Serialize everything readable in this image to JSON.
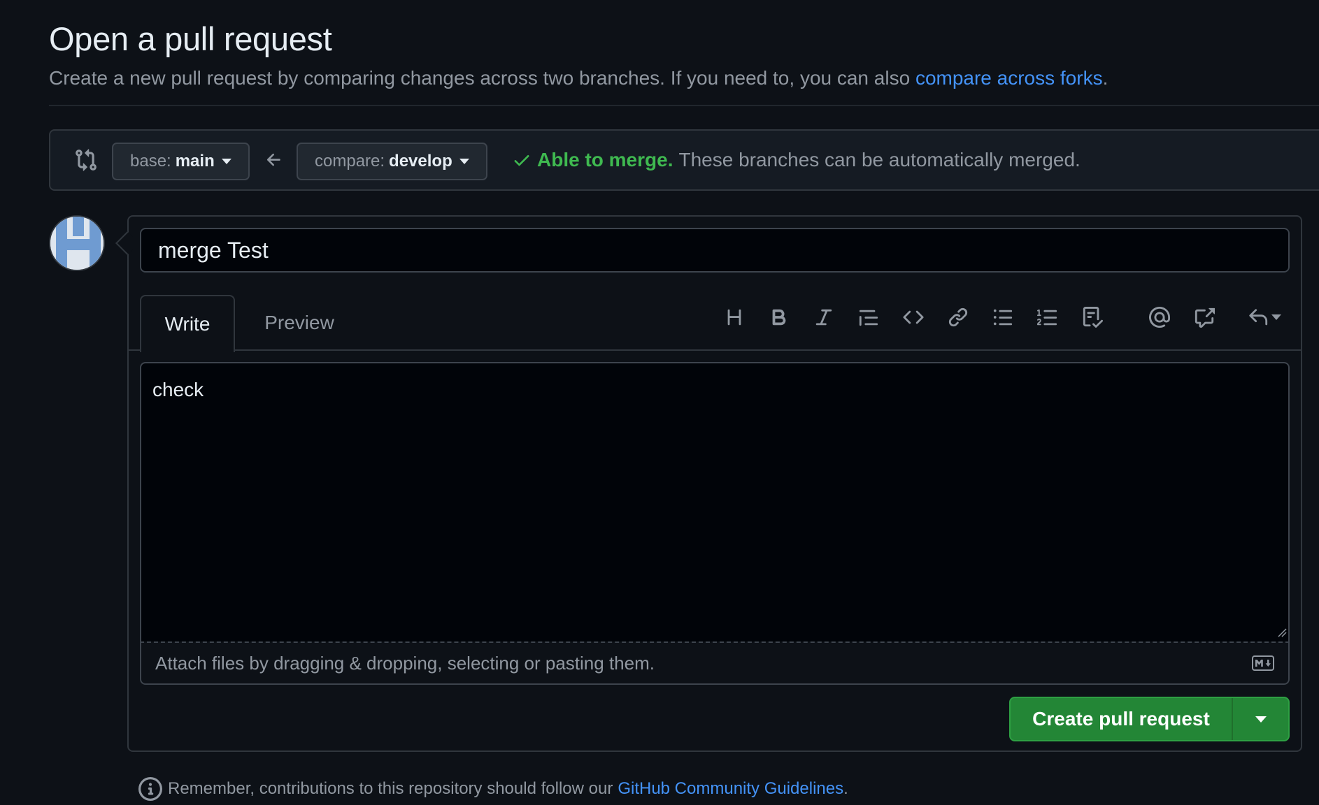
{
  "header": {
    "title": "Open a pull request",
    "subtitle": "Create a new pull request by comparing changes across two branches. If you need to, you can also",
    "subtitle_link": "compare across forks",
    "subtitle_end": "."
  },
  "compare": {
    "base_prefix": "base:",
    "base_branch": "main",
    "compare_prefix": "compare:",
    "compare_branch": "develop",
    "merge_ok": "Able to merge.",
    "merge_text": "These branches can be automatically merged."
  },
  "form": {
    "title_value": "merge Test",
    "tabs": [
      "Write",
      "Preview"
    ],
    "body_value": "check",
    "attach_text": "Attach files by dragging & dropping, selecting or pasting them."
  },
  "toolbar_icons": [
    "heading-icon",
    "bold-icon",
    "italic-icon",
    "quote-icon",
    "code-icon",
    "link-icon",
    "unordered-list-icon",
    "ordered-list-icon",
    "task-list-icon",
    "mention-icon",
    "cross-reference-icon",
    "saved-replies-icon"
  ],
  "submit": {
    "label": "Create pull request"
  },
  "footer": {
    "text": "Remember, contributions to this repository should follow our",
    "link": "GitHub Community Guidelines",
    "end": "."
  },
  "colors": {
    "background": "#0d1117",
    "accent_link": "#4493f8",
    "success": "#3fb950",
    "button_green": "#238636"
  }
}
